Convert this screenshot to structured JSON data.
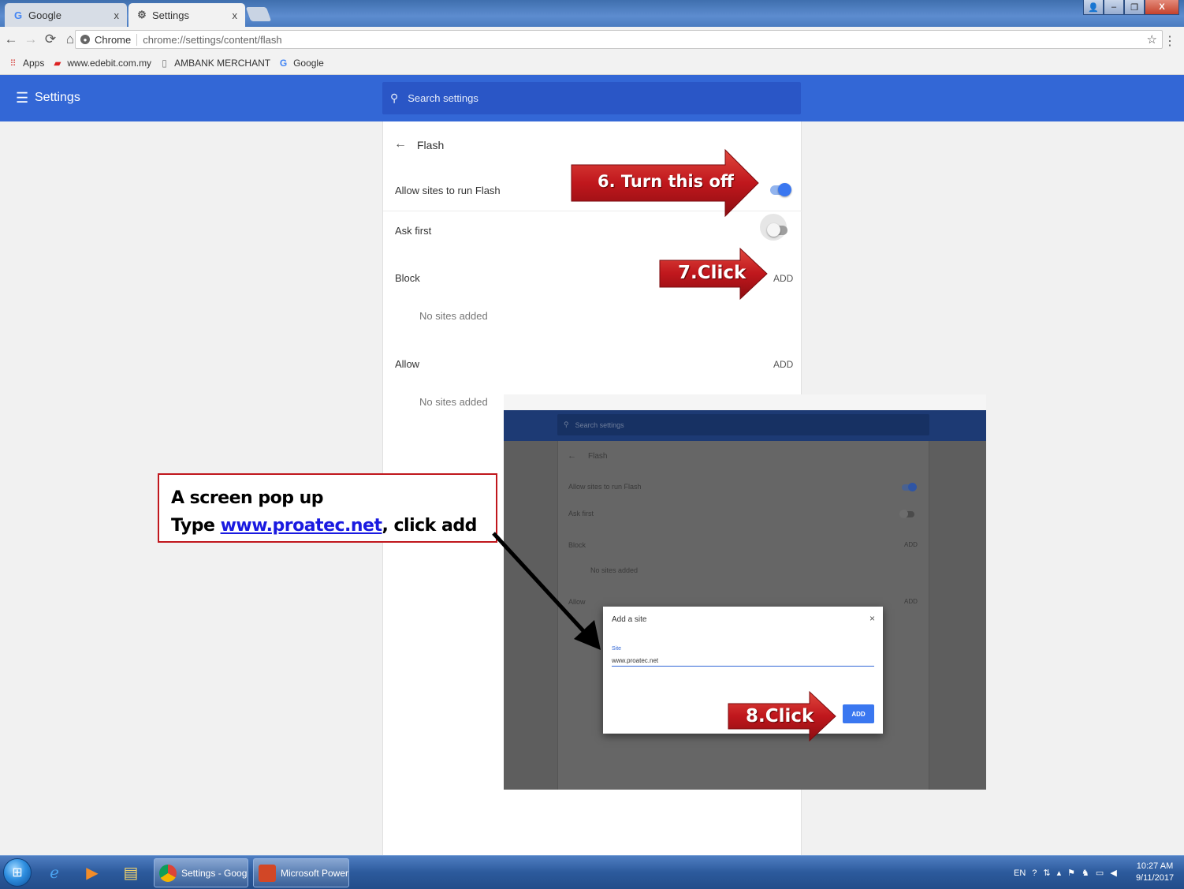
{
  "browser": {
    "tabs": [
      {
        "title": "Google",
        "icon": "google-g-icon",
        "close": "x"
      },
      {
        "title": "Settings",
        "icon": "gear-icon",
        "close": "x"
      }
    ],
    "omnibox": {
      "chip": "Chrome",
      "url": "chrome://settings/content/flash"
    },
    "bookmarks": [
      {
        "label": "Apps",
        "icon": "apps-grid-icon"
      },
      {
        "label": "www.edebit.com.my",
        "icon": "edebit-icon"
      },
      {
        "label": "AMBANK MERCHANT",
        "icon": "page-icon"
      },
      {
        "label": "Google",
        "icon": "google-g-icon"
      }
    ]
  },
  "settings": {
    "title": "Settings",
    "search_placeholder": "Search settings",
    "page_title": "Flash",
    "allow_flash_label": "Allow sites to run Flash",
    "allow_flash_on": true,
    "ask_first_label": "Ask first",
    "ask_first_on": false,
    "block_label": "Block",
    "block_add": "ADD",
    "block_empty": "No sites added",
    "allow_label": "Allow",
    "allow_add": "ADD",
    "allow_empty": "No sites added"
  },
  "inset": {
    "search_placeholder": "Search settings",
    "page_title": "Flash",
    "allow_flash_label": "Allow sites to run Flash",
    "ask_first_label": "Ask first",
    "block_label": "Block",
    "block_add": "ADD",
    "block_empty": "No sites added",
    "allow_label": "Allow",
    "allow_add": "ADD",
    "dialog": {
      "title": "Add a site",
      "close": "×",
      "field_label": "Site",
      "field_value": "www.proatec.net",
      "add_button": "ADD"
    }
  },
  "annotations": {
    "step6": "6. Turn this off",
    "step7": "7.Click",
    "step8": "8.Click",
    "note_line1": "A screen pop up",
    "note_line2_prefix": "Type ",
    "note_link": "www.proatec.net",
    "note_line2_suffix": ", click add",
    "colors": {
      "arrow": "#c0171d",
      "note_border": "#c0171d",
      "header": "#3367d6"
    }
  },
  "taskbar": {
    "tasks": [
      {
        "label": "Settings - Google ...",
        "icon": "chrome-icon"
      },
      {
        "label": "Microsoft PowerP...",
        "icon": "powerpoint-icon"
      }
    ],
    "language": "EN",
    "time": "10:27 AM",
    "date": "9/11/2017"
  }
}
